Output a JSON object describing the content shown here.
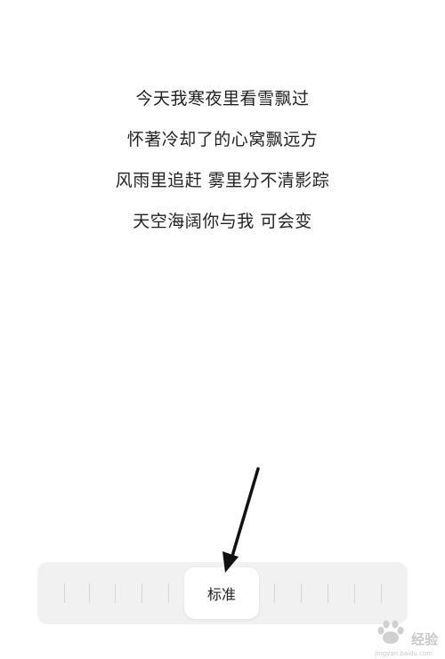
{
  "lyrics": [
    "今天我寒夜里看雪飘过",
    "怀著冷却了的心窝飘远方",
    "风雨里追赶 雾里分不清影踪",
    "天空海阔你与我 可会变"
  ],
  "size_slider": {
    "selected_label": "标准"
  },
  "watermark": {
    "text": "经验",
    "url": "jingyan.baidu.com"
  },
  "colors": {
    "text": "#222222",
    "slider_track": "#f1f1f1",
    "tick": "#d6d6d6",
    "annotation_arrow": "#111111"
  }
}
